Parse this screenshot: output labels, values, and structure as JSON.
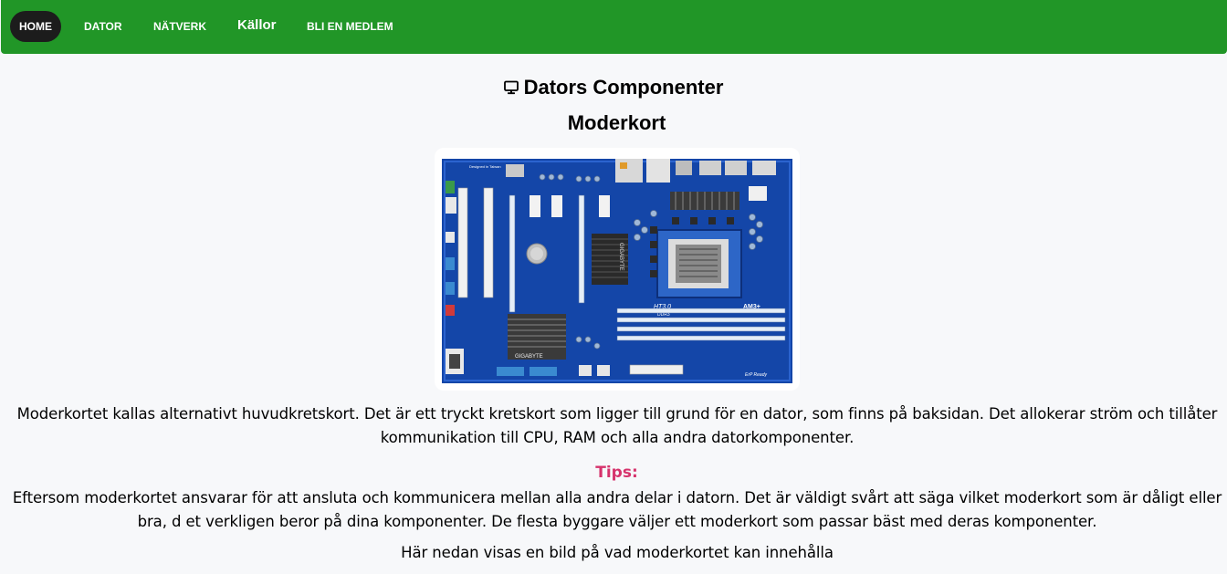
{
  "nav": {
    "items": [
      {
        "label": "HOME"
      },
      {
        "label": "DATOR"
      },
      {
        "label": "NÄTVERK"
      },
      {
        "label": "Källor"
      },
      {
        "label": "BLI EN MEDLEM"
      }
    ]
  },
  "page": {
    "title": "Dators Componenter",
    "title_icon": "monitor-icon",
    "section_title": "Moderkort",
    "image_icon": "motherboard-image",
    "image_text": {
      "brand": "GIGABYTE",
      "tagline": "Designed in Taiwan",
      "socket": "AM3+",
      "bus": "HT3.0",
      "memory": "DDR3",
      "ready": "ErP Ready"
    },
    "description": "Moderkortet kallas alternativt huvudkretskort. Det är ett tryckt kretskort som ligger till grund för en dator, som finns på baksidan. Det allokerar ström och tillåter kommunikation till CPU, RAM och alla andra datorkomponenter.",
    "tips_label": "Tips:",
    "tips_text": "Eftersom moderkortet ansvarar för att ansluta och kommunicera mellan alla andra delar i datorn. Det är väldigt svårt att säga vilket moderkort som är dåligt eller bra, d et verkligen beror på dina komponenter. De flesta byggare väljer ett moderkort som passar bäst med deras komponenter.",
    "footer_note": "Här nedan visas en bild på vad moderkortet kan innehålla"
  },
  "colors": {
    "navbar": "#219627",
    "active_nav": "#1c1c1c",
    "tips": "#d6336c",
    "background": "#f7f8fa",
    "board": "#1446a8"
  }
}
